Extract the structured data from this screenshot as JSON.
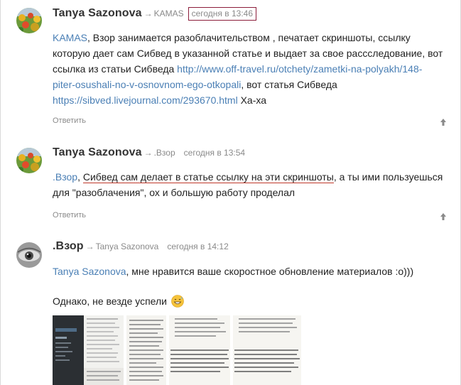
{
  "comments": [
    {
      "author": "Tanya Sazonova",
      "arrow": "→",
      "reply_to": "KAMAS",
      "time": "сегодня в 13:46",
      "text": {
        "l1_mention": "KAMAS",
        "l1_rest": ", Взор занимается разоблачительством , печатает скриншоты, ссылку",
        "l2": "которую дает сам Сибвед в указанной статье и выдает за свое рассследование, вот",
        "l3_a": "ссылка из статьи Сибведа ",
        "l3_link": "http://www.off-travel.ru/otchety/zametki-na-polyakh/148-",
        "l4_link": "piter-osushali-no-v-osnovnom-ego-otkopali",
        "l4_rest": ", вот статья Сибведа",
        "l5_link": "https://sibved.livejournal.com/293670.html",
        "l5_rest": " Ха-ха"
      },
      "reply_label": "Ответить"
    },
    {
      "author": "Tanya Sazonova",
      "arrow": "→",
      "reply_to": ".Взор",
      "time": "сегодня в 13:54",
      "text": {
        "l1_mention": ".Взор",
        "l1_sep": ", ",
        "l1_underlined": "Сибвед сам делает в статье ссылку на эти скриншоты",
        "l1_rest": ", а ты ими пользуешься",
        "l2": "для \"разоблачения\", ох и большую работу проделал"
      },
      "reply_label": "Ответить"
    },
    {
      "author": ".Взор",
      "arrow": "→",
      "reply_to": "Tanya Sazonova",
      "time": "сегодня в 14:12",
      "text": {
        "l1_mention": "Tanya Sazonova",
        "l1_rest": ", мне нравится ваше скоростное обновление материалов :о)))",
        "l2": "Однако, не везде успели"
      }
    }
  ],
  "icons": {
    "reply_up": "up-arrow-icon",
    "emoji": "grinning-sweat-emoji"
  },
  "colors": {
    "link": "#4a7fb5",
    "meta": "#8a8a8a",
    "highlight_box": "#8b1d3a",
    "underline": "#c0392b"
  }
}
